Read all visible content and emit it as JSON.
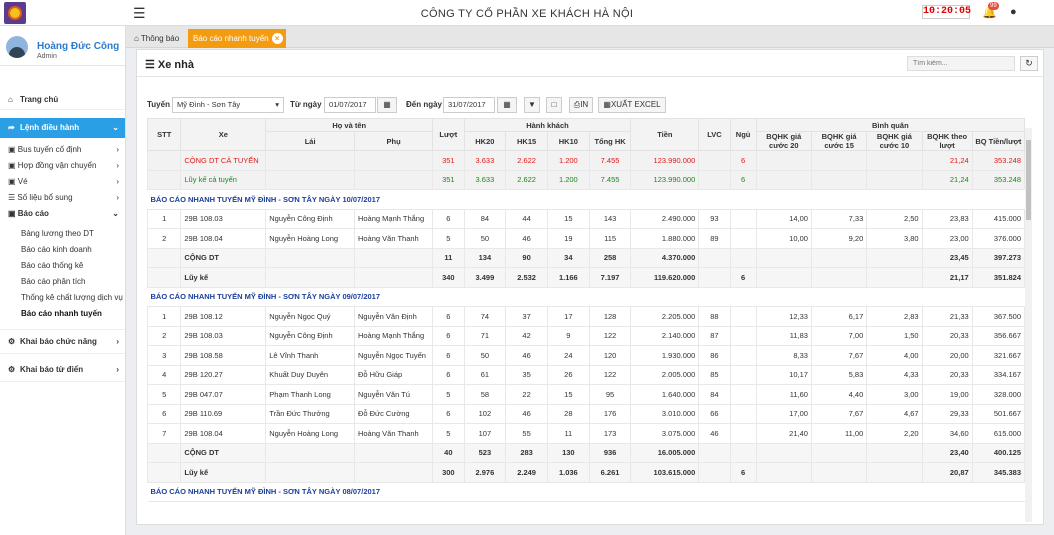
{
  "company": "CÔNG TY CỔ PHẦN XE KHÁCH HÀ NỘI",
  "clock": "10:20:05",
  "bell_count": "99",
  "user": {
    "name": "Hoàng Đức Công",
    "role": "Admin"
  },
  "nav": {
    "home": "Trang chủ",
    "lenh": "Lệnh điều hành",
    "subs": [
      "Bus tuyến cố định",
      "Hợp đồng vận chuyển",
      "Vé",
      "Số liệu bổ sung"
    ],
    "baocao": "Báo cáo",
    "baocao_items": [
      "Bảng lương theo DT",
      "Báo cáo kinh doanh",
      "Báo cáo thống kê",
      "Báo cáo phân tích",
      "Thống kê chất lượng dịch vụ",
      "Báo cáo nhanh tuyến"
    ],
    "khaibao": "Khai báo chức năng",
    "tudien": "Khai báo từ điển"
  },
  "tabs": {
    "home": "Thông báo",
    "active": "Báo cáo nhanh tuyến"
  },
  "page_title": "Xe nhà",
  "search_placeholder": "Tìm kiếm...",
  "filters": {
    "tuyen_label": "Tuyến",
    "tuyen_value": "Mỹ Đình - Sơn Tây",
    "tu_label": "Từ ngày",
    "tu_value": "01/07/2017",
    "den_label": "Đến ngày",
    "den_value": "31/07/2017",
    "print": "IN",
    "export": "XUẤT EXCEL"
  },
  "headers": {
    "stt": "STT",
    "xe": "Xe",
    "hoten": "Họ và tên",
    "lai": "Lái",
    "phu": "Phụ",
    "luot": "Lượt",
    "hanhkhach": "Hành khách",
    "hk20": "HK20",
    "hk15": "HK15",
    "hk10": "HK10",
    "tonghk": "Tổng HK",
    "tien": "Tiền",
    "lvc": "LVC",
    "ngu": "Ngủ",
    "binhquan": "Bình quân",
    "b20": "BQHK giá cước 20",
    "b15": "BQHK giá cước 15",
    "b10": "BQHK giá cước 10",
    "bluot": "BQHK theo lượt",
    "btien": "BQ Tiền/lượt"
  },
  "rows": [
    {
      "t": "red",
      "c": [
        "",
        "CỘNG DT CẢ TUYẾN",
        "",
        "",
        "351",
        "3.633",
        "2.622",
        "1.200",
        "7.455",
        "123.990.000",
        "",
        "6",
        "",
        "",
        "",
        "21,24",
        "353.248"
      ]
    },
    {
      "t": "green",
      "c": [
        "",
        "Lũy kế cả tuyến",
        "",
        "",
        "351",
        "3.633",
        "2.622",
        "1.200",
        "7.455",
        "123.990.000",
        "",
        "6",
        "",
        "",
        "",
        "21,24",
        "353.248"
      ]
    },
    {
      "t": "sec",
      "c": [
        "BÁO CÁO NHANH TUYẾN MỸ ĐÌNH - SƠN TÂY NGÀY 10/07/2017"
      ]
    },
    {
      "t": "d",
      "c": [
        "1",
        "29B 108.03",
        "Nguyễn Công Định",
        "Hoàng Mạnh Thắng",
        "6",
        "84",
        "44",
        "15",
        "143",
        "2.490.000",
        "93",
        "",
        "14,00",
        "7,33",
        "2,50",
        "23,83",
        "415.000"
      ]
    },
    {
      "t": "d",
      "c": [
        "2",
        "29B 108.04",
        "Nguyễn Hoàng Long",
        "Hoàng Văn Thanh",
        "5",
        "50",
        "46",
        "19",
        "115",
        "1.880.000",
        "89",
        "",
        "10,00",
        "9,20",
        "3,80",
        "23,00",
        "376.000"
      ]
    },
    {
      "t": "tot",
      "c": [
        "",
        "CỘNG DT",
        "",
        "",
        "11",
        "134",
        "90",
        "34",
        "258",
        "4.370.000",
        "",
        "",
        "",
        "",
        "",
        "23,45",
        "397.273"
      ]
    },
    {
      "t": "tot",
      "c": [
        "",
        "Lũy kế",
        "",
        "",
        "340",
        "3.499",
        "2.532",
        "1.166",
        "7.197",
        "119.620.000",
        "",
        "6",
        "",
        "",
        "",
        "21,17",
        "351.824"
      ]
    },
    {
      "t": "sec",
      "c": [
        "BÁO CÁO NHANH TUYẾN MỸ ĐÌNH - SƠN TÂY NGÀY 09/07/2017"
      ]
    },
    {
      "t": "d",
      "c": [
        "1",
        "29B 108.12",
        "Nguyễn Ngọc Quý",
        "Nguyễn Văn Định",
        "6",
        "74",
        "37",
        "17",
        "128",
        "2.205.000",
        "88",
        "",
        "12,33",
        "6,17",
        "2,83",
        "21,33",
        "367.500"
      ]
    },
    {
      "t": "d",
      "c": [
        "2",
        "29B 108.03",
        "Nguyễn Công Định",
        "Hoàng Mạnh Thắng",
        "6",
        "71",
        "42",
        "9",
        "122",
        "2.140.000",
        "87",
        "",
        "11,83",
        "7,00",
        "1,50",
        "20,33",
        "356.667"
      ]
    },
    {
      "t": "d",
      "c": [
        "3",
        "29B 108.58",
        "Lê Vĩnh Thanh",
        "Nguyễn Ngọc Tuyến",
        "6",
        "50",
        "46",
        "24",
        "120",
        "1.930.000",
        "86",
        "",
        "8,33",
        "7,67",
        "4,00",
        "20,00",
        "321.667"
      ]
    },
    {
      "t": "d",
      "c": [
        "4",
        "29B 120.27",
        "Khuất Duy Duyên",
        "Đỗ Hữu Giáp",
        "6",
        "61",
        "35",
        "26",
        "122",
        "2.005.000",
        "85",
        "",
        "10,17",
        "5,83",
        "4,33",
        "20,33",
        "334.167"
      ]
    },
    {
      "t": "d",
      "c": [
        "5",
        "29B 047.07",
        "Phạm Thanh Long",
        "Nguyễn Văn Tú",
        "5",
        "58",
        "22",
        "15",
        "95",
        "1.640.000",
        "84",
        "",
        "11,60",
        "4,40",
        "3,00",
        "19,00",
        "328.000"
      ]
    },
    {
      "t": "d",
      "c": [
        "6",
        "29B 110.69",
        "Trần Đức Thưởng",
        "Đỗ Đức Cường",
        "6",
        "102",
        "46",
        "28",
        "176",
        "3.010.000",
        "66",
        "",
        "17,00",
        "7,67",
        "4,67",
        "29,33",
        "501.667"
      ]
    },
    {
      "t": "d",
      "c": [
        "7",
        "29B 108.04",
        "Nguyễn Hoàng Long",
        "Hoàng Văn Thanh",
        "5",
        "107",
        "55",
        "11",
        "173",
        "3.075.000",
        "46",
        "",
        "21,40",
        "11,00",
        "2,20",
        "34,60",
        "615.000"
      ]
    },
    {
      "t": "tot",
      "c": [
        "",
        "CỘNG DT",
        "",
        "",
        "40",
        "523",
        "283",
        "130",
        "936",
        "16.005.000",
        "",
        "",
        "",
        "",
        "",
        "23,40",
        "400.125"
      ]
    },
    {
      "t": "tot",
      "c": [
        "",
        "Lũy kế",
        "",
        "",
        "300",
        "2.976",
        "2.249",
        "1.036",
        "6.261",
        "103.615.000",
        "",
        "6",
        "",
        "",
        "",
        "20,87",
        "345.383"
      ]
    },
    {
      "t": "sec",
      "c": [
        "BÁO CÁO NHANH TUYẾN MỸ ĐÌNH - SƠN TÂY NGÀY 08/07/2017"
      ]
    }
  ]
}
